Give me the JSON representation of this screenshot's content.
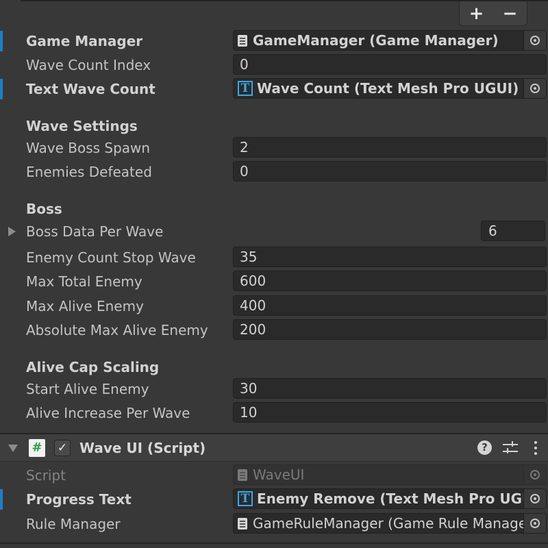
{
  "list_controls": {
    "add": "+",
    "remove": "−"
  },
  "game_rule": {
    "game_manager": {
      "label": "Game Manager",
      "value": "GameManager (Game Manager)"
    },
    "wave_count_index": {
      "label": "Wave Count Index",
      "value": "0"
    },
    "text_wave_count": {
      "label": "Text Wave Count",
      "value": "Wave Count (Text Mesh Pro UGUI)"
    },
    "wave_settings": {
      "header": "Wave Settings",
      "wave_boss_spawn": {
        "label": "Wave Boss Spawn",
        "value": "2"
      },
      "enemies_defeated": {
        "label": "Enemies Defeated",
        "value": "0"
      }
    },
    "boss": {
      "header": "Boss",
      "boss_data_per_wave": {
        "label": "Boss Data Per Wave",
        "value": "6"
      },
      "enemy_count_stop_wave": {
        "label": "Enemy Count Stop Wave",
        "value": "35"
      },
      "max_total_enemy": {
        "label": "Max Total Enemy",
        "value": "600"
      },
      "max_alive_enemy": {
        "label": "Max Alive Enemy",
        "value": "400"
      },
      "absolute_max_alive_enemy": {
        "label": "Absolute Max Alive Enemy",
        "value": "200"
      }
    },
    "alive_cap_scaling": {
      "header": "Alive Cap Scaling",
      "start_alive_enemy": {
        "label": "Start Alive Enemy",
        "value": "30"
      },
      "alive_increase_per_wave": {
        "label": "Alive Increase Per Wave",
        "value": "10"
      }
    }
  },
  "wave_ui_component": {
    "hash_glyph": "#",
    "check_glyph": "✓",
    "help_glyph": "?",
    "title": "Wave UI (Script)",
    "script": {
      "label": "Script",
      "value": "WaveUI"
    },
    "progress_text": {
      "label": "Progress Text",
      "value": "Enemy Remove (Text Mesh Pro UGUI)"
    },
    "rule_manager": {
      "label": "Rule Manager",
      "value": "GameRuleManager (Game Rule Manager)"
    }
  },
  "icons": {
    "tmp_icon_glyph": "T",
    "colors": {
      "override": "#1d7fc7",
      "tmp": "#3aa7e8",
      "script_hash": "#2f9b4a"
    }
  }
}
